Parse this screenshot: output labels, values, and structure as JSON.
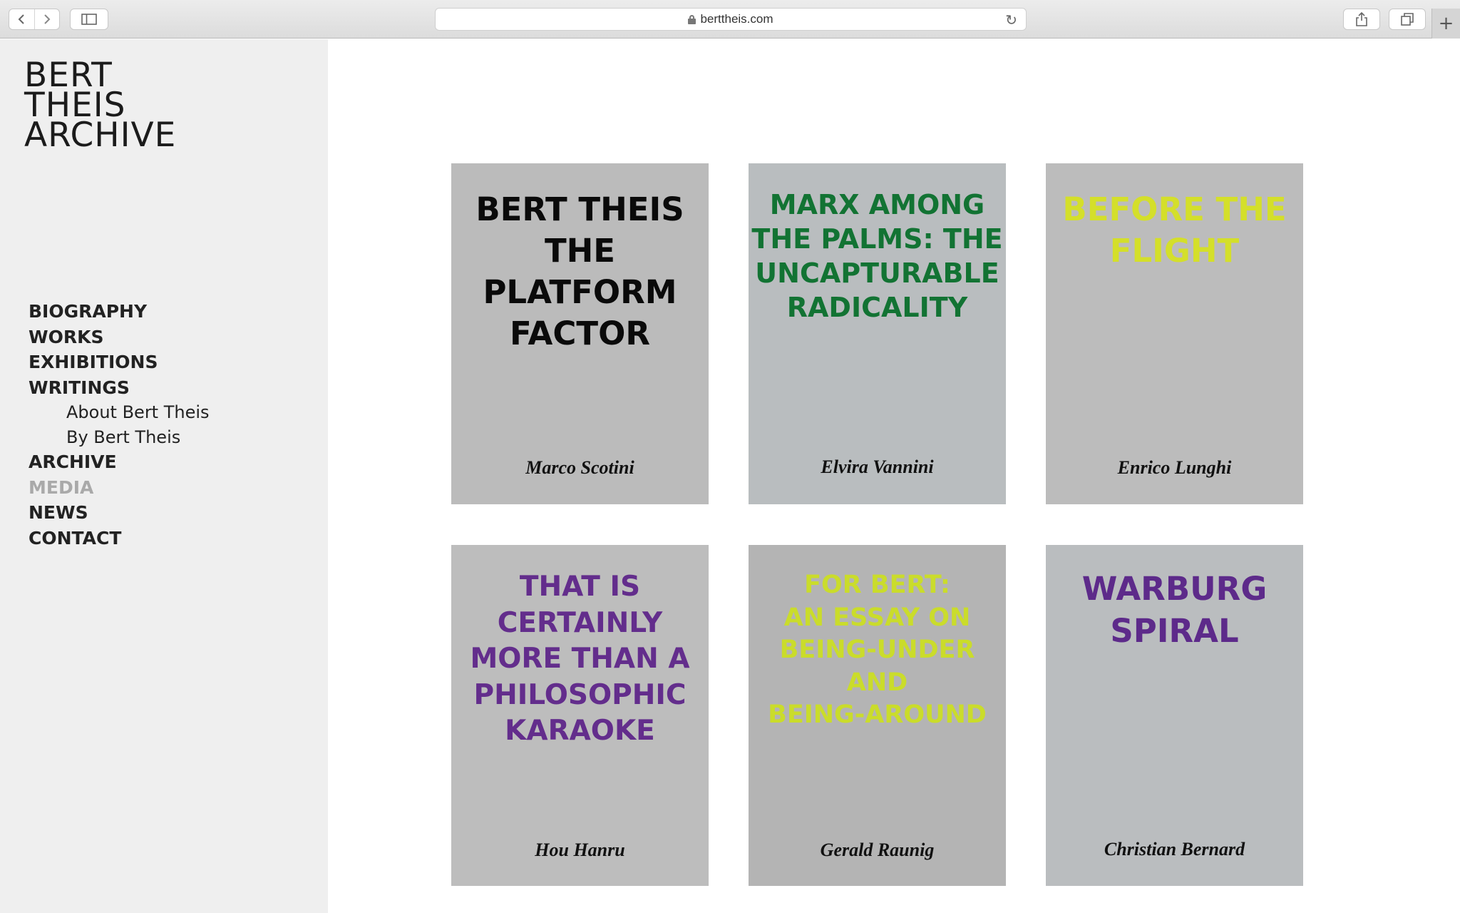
{
  "browser": {
    "url": "berttheis.com",
    "back_icon": "chevron-left-icon",
    "forward_icon": "chevron-right-icon"
  },
  "sidebar": {
    "logo_lines": [
      "BERT",
      "THEIS",
      "ARCHIVE"
    ],
    "nav": [
      {
        "label": "BIOGRAPHY"
      },
      {
        "label": "WORKS"
      },
      {
        "label": "EXHIBITIONS"
      },
      {
        "label": "WRITINGS"
      },
      {
        "label": "About Bert Theis",
        "sub": true
      },
      {
        "label": "By Bert Theis",
        "sub": true
      },
      {
        "label": "ARCHIVE"
      },
      {
        "label": "MEDIA",
        "active": true
      },
      {
        "label": "NEWS"
      },
      {
        "label": "CONTACT"
      }
    ]
  },
  "cards": [
    {
      "title_lines": [
        "BERT THEIS",
        "THE",
        "PLATFORM",
        "FACTOR"
      ],
      "author": "Marco Scotini",
      "bg": "#bbbbbb",
      "title_color": "#0a0a0a"
    },
    {
      "title_lines": [
        "MARX AMONG",
        "THE PALMS: THE",
        "UNCAPTURABLE",
        "RADICALITY"
      ],
      "author": "Elvira Vannini",
      "bg": "#b9bdbf",
      "title_color": "#127333"
    },
    {
      "title_lines": [
        "BEFORE THE",
        "FLIGHT"
      ],
      "author": "Enrico Lunghi",
      "bg": "#bcbcbc",
      "title_color": "#d4df2a"
    },
    {
      "title_lines": [
        "THAT IS",
        "CERTAINLY",
        "MORE THAN A",
        "PHILOSOPHIC",
        "KARAOKE"
      ],
      "author": "Hou Hanru",
      "bg": "#bdbdbd",
      "title_color": "#632d8c"
    },
    {
      "title_lines": [
        "FOR BERT:",
        "AN ESSAY ON",
        "BEING-UNDER",
        "AND",
        "BEING-AROUND"
      ],
      "author": "Gerald Raunig",
      "bg": "#b4b4b4",
      "title_color": "#cadc2b"
    },
    {
      "title_lines": [
        "WARBURG",
        "SPIRAL"
      ],
      "author": "Christian Bernard",
      "bg": "#babdbf",
      "title_color": "#5d2a8a"
    }
  ]
}
